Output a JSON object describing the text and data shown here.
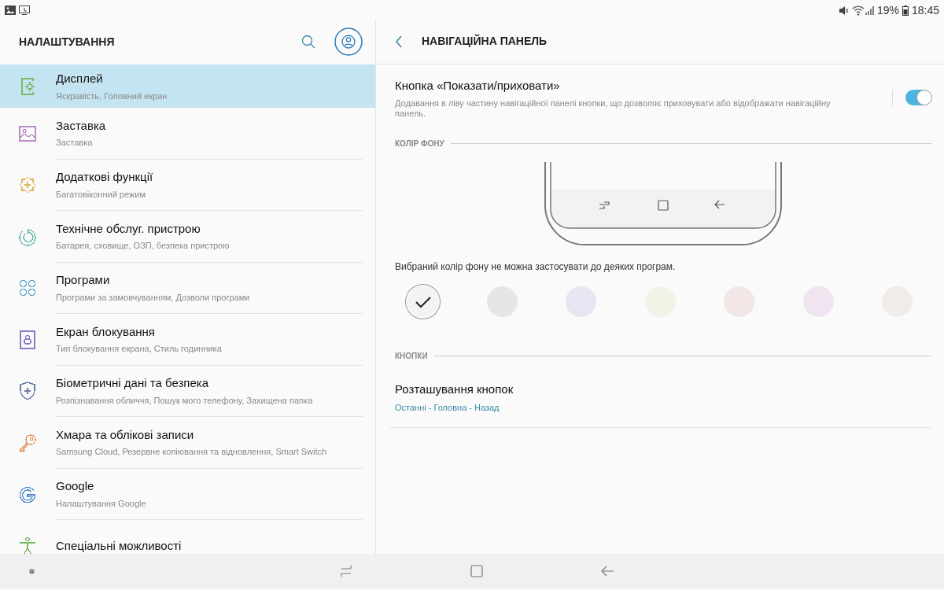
{
  "status_bar": {
    "battery": "19%",
    "time": "18:45"
  },
  "settings": {
    "title": "НАЛАШТУВАННЯ",
    "items": [
      {
        "title": "Дисплей",
        "subtitle": "Яскравість, Головний екран",
        "selected": true,
        "color": "#7cb86a"
      },
      {
        "title": "Заставка",
        "subtitle": "Заставка",
        "selected": false,
        "color": "#b88cc4"
      },
      {
        "title": "Додаткові функції",
        "subtitle": "Багатовіконний режим",
        "selected": false,
        "color": "#e0b45a"
      },
      {
        "title": "Технічне обслуг. пристрою",
        "subtitle": "Батарея, сховище, ОЗП, безпека пристрою",
        "selected": false,
        "color": "#5ab8a8"
      },
      {
        "title": "Програми",
        "subtitle": "Програми за замовчуванням, Дозволи програми",
        "selected": false,
        "color": "#5aaad0"
      },
      {
        "title": "Екран блокування",
        "subtitle": "Тип блокування екрана, Стиль годинника",
        "selected": false,
        "color": "#8a7cc8"
      },
      {
        "title": "Біометричні дані та безпека",
        "subtitle": "Розпізнавання обличчя, Пошук мого телефону, Захищена папка",
        "selected": false,
        "color": "#6a7aa8"
      },
      {
        "title": "Хмара та облікові записи",
        "subtitle": "Samsung Cloud, Резервне копіювання та відновлення, Smart Switch",
        "selected": false,
        "color": "#e0905a"
      },
      {
        "title": "Google",
        "subtitle": "Налаштування Google",
        "selected": false,
        "color": "#4a86c8"
      },
      {
        "title": "Спеціальні можливості",
        "selected": false,
        "color": "#7cb86a"
      }
    ]
  },
  "detail": {
    "title": "НАВІГАЦІЙНА ПАНЕЛЬ",
    "toggle": {
      "title": "Кнопка «Показати/приховати»",
      "description": "Додавання в ліву частину навігаційної панелі кнопки, що дозволяє приховувати або відображати навігаційну панель.",
      "on": true
    },
    "background_section": "КОЛІР ФОНУ",
    "note": "Вибраний колір фону не можна застосувати до деяких програм.",
    "swatches": [
      {
        "color": "#f3f3f3",
        "selected": true
      },
      {
        "color": "#e6e6e6",
        "selected": false
      },
      {
        "color": "#e6e6f2",
        "selected": false
      },
      {
        "color": "#f2f2e6",
        "selected": false
      },
      {
        "color": "#f2e6e6",
        "selected": false
      },
      {
        "color": "#f0e4f0",
        "selected": false
      },
      {
        "color": "#f2ece8",
        "selected": false
      }
    ],
    "buttons_section": "КНОПКИ",
    "layout": {
      "title": "Розташування кнопок",
      "value": "Останні - Головна - Назад"
    }
  }
}
